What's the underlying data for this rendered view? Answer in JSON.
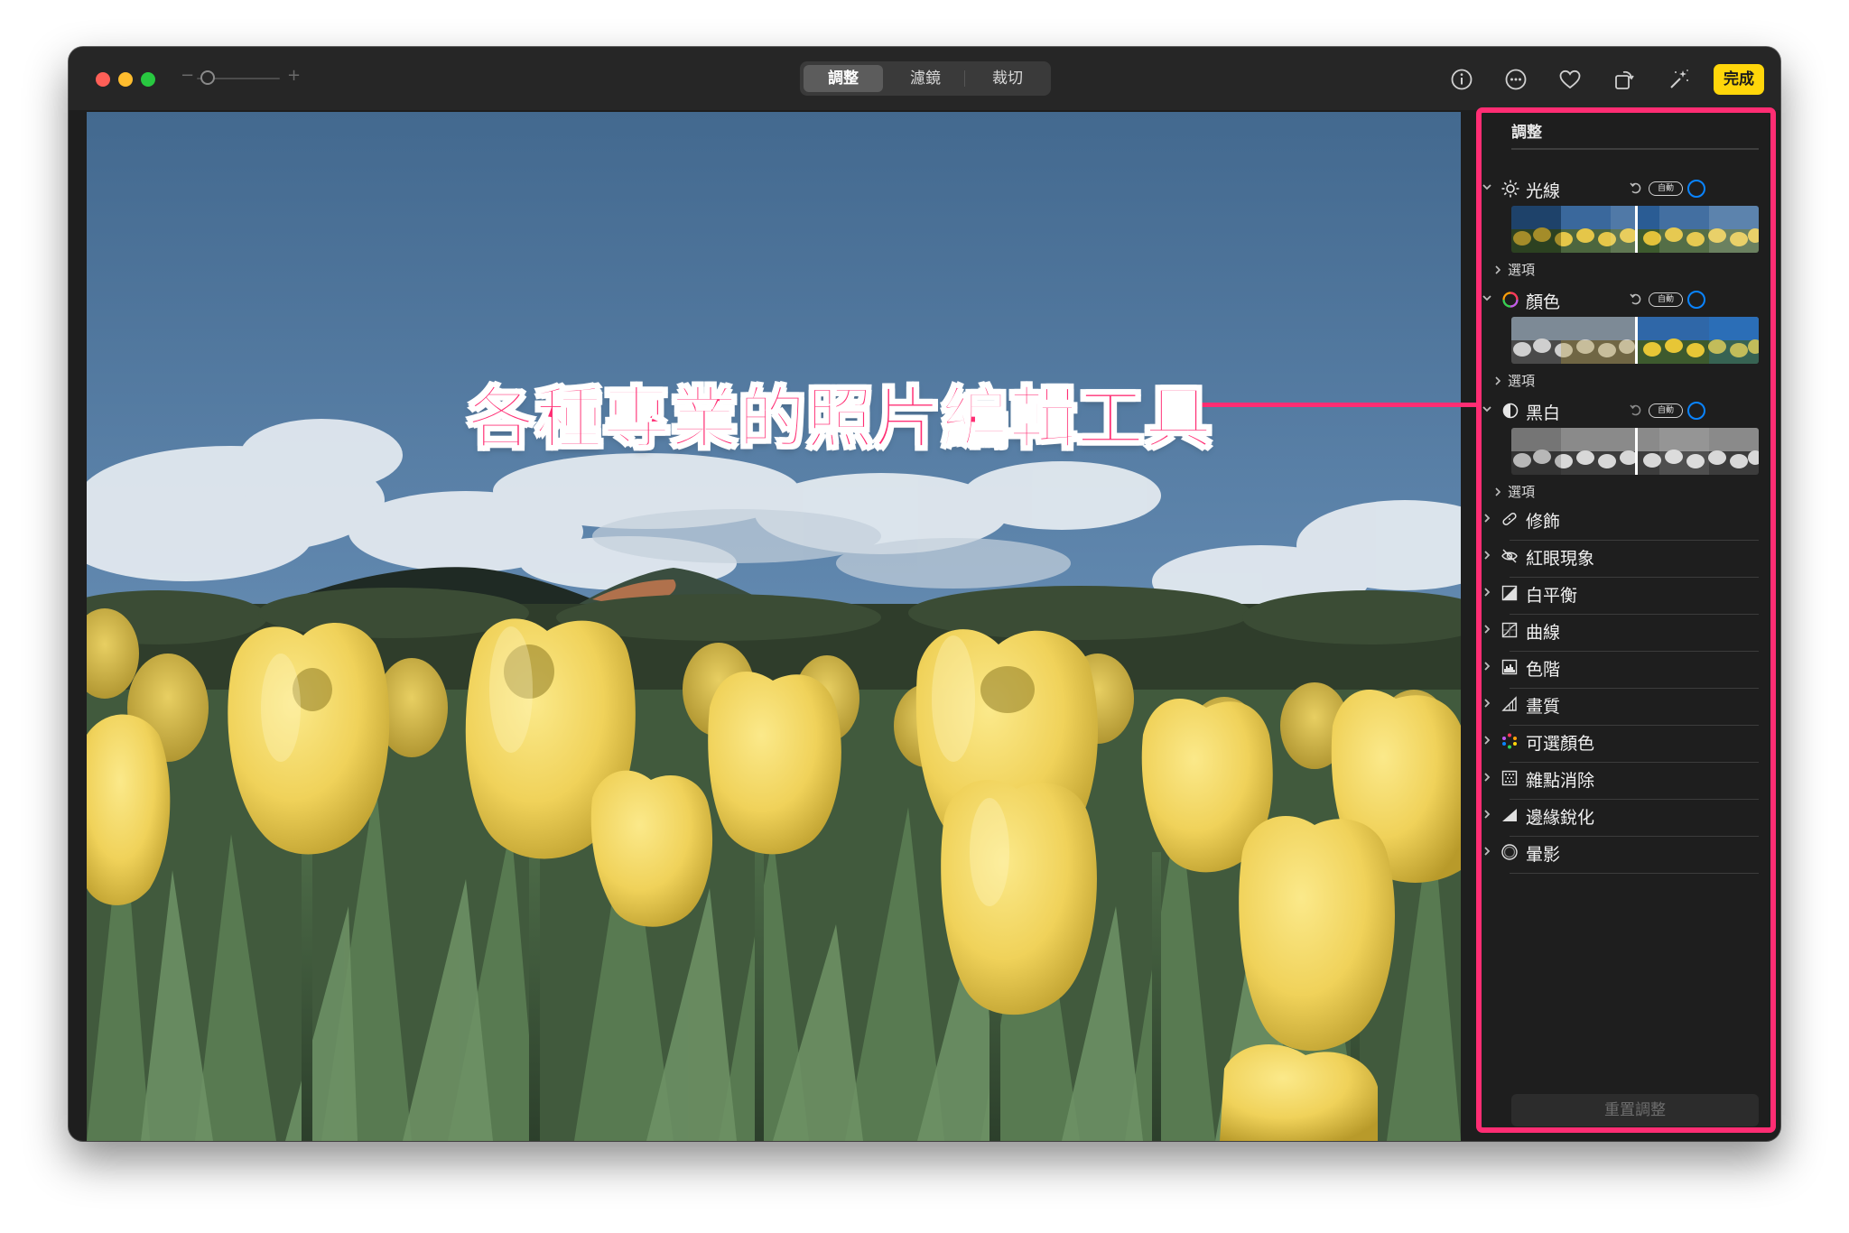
{
  "toolbar": {
    "zoom_minus": "−",
    "zoom_plus": "+",
    "tabs": [
      {
        "label": "調整",
        "active": true
      },
      {
        "label": "濾鏡",
        "active": false
      },
      {
        "label": "裁切",
        "active": false
      }
    ],
    "icons": [
      "info-icon",
      "more-icon",
      "heart-icon",
      "rotate-icon",
      "magic-wand-icon"
    ],
    "done_label": "完成",
    "done_color": "#ffd60a"
  },
  "sidebar": {
    "title": "調整",
    "sections": [
      {
        "label": "光線",
        "icon": "sun-icon",
        "auto_label": "自動",
        "options_label": "選項"
      },
      {
        "label": "顏色",
        "icon": "color-ring-icon",
        "auto_label": "自動",
        "options_label": "選項"
      },
      {
        "label": "黑白",
        "icon": "half-circle-icon",
        "auto_label": "自動",
        "options_label": "選項"
      }
    ],
    "tools": [
      {
        "label": "修飾",
        "icon": "bandage-icon"
      },
      {
        "label": "紅眼現象",
        "icon": "eye-icon"
      },
      {
        "label": "白平衡",
        "icon": "white-balance-icon"
      },
      {
        "label": "曲線",
        "icon": "curves-icon"
      },
      {
        "label": "色階",
        "icon": "levels-icon"
      },
      {
        "label": "畫質",
        "icon": "definition-icon"
      },
      {
        "label": "可選顏色",
        "icon": "selective-color-icon"
      },
      {
        "label": "雜點消除",
        "icon": "noise-reduction-icon"
      },
      {
        "label": "邊緣銳化",
        "icon": "sharpen-icon"
      },
      {
        "label": "暈影",
        "icon": "vignette-icon"
      }
    ],
    "reset_label": "重置調整"
  },
  "annotation": {
    "text": "各種專業的照片編輯工具",
    "color": "#ff2d73"
  },
  "accent_color": "#0a84ff"
}
